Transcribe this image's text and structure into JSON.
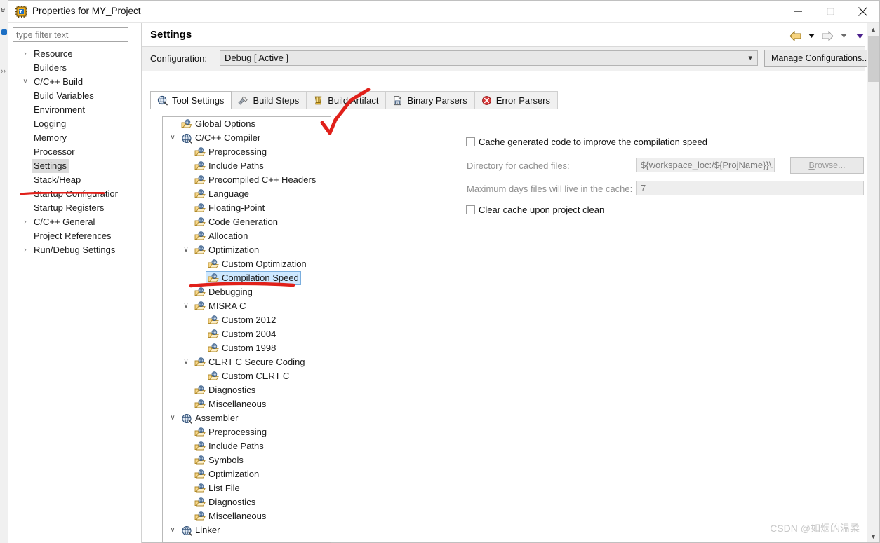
{
  "window": {
    "title": "Properties for MY_Project",
    "icon": "properties-chip-icon",
    "minimize_label": "—",
    "maximize_label": "□",
    "close_label": "✕"
  },
  "sidebar": {
    "filter_placeholder": "type filter text",
    "filter_value": "",
    "items": [
      {
        "label": "Resource",
        "indent": 0,
        "twisty": "collapsed",
        "selected": false
      },
      {
        "label": "Builders",
        "indent": 0,
        "twisty": "none",
        "selected": false
      },
      {
        "label": "C/C++ Build",
        "indent": 0,
        "twisty": "expanded",
        "selected": false
      },
      {
        "label": "Build Variables",
        "indent": 1,
        "twisty": "none",
        "selected": false
      },
      {
        "label": "Environment",
        "indent": 1,
        "twisty": "none",
        "selected": false
      },
      {
        "label": "Logging",
        "indent": 1,
        "twisty": "none",
        "selected": false
      },
      {
        "label": "Memory",
        "indent": 1,
        "twisty": "none",
        "selected": false
      },
      {
        "label": "Processor",
        "indent": 1,
        "twisty": "none",
        "selected": false
      },
      {
        "label": "Settings",
        "indent": 1,
        "twisty": "none",
        "selected": true
      },
      {
        "label": "Stack/Heap",
        "indent": 1,
        "twisty": "none",
        "selected": false
      },
      {
        "label": "Startup Configuratior",
        "indent": 1,
        "twisty": "none",
        "selected": false
      },
      {
        "label": "Startup Registers",
        "indent": 1,
        "twisty": "none",
        "selected": false
      },
      {
        "label": "C/C++ General",
        "indent": 0,
        "twisty": "collapsed",
        "selected": false
      },
      {
        "label": "Project References",
        "indent": 0,
        "twisty": "none",
        "selected": false
      },
      {
        "label": "Run/Debug Settings",
        "indent": 0,
        "twisty": "collapsed",
        "selected": false
      }
    ]
  },
  "page": {
    "title": "Settings",
    "nav": {
      "back_icon": "back-arrow-icon",
      "back_menu_icon": "chevron-down-icon",
      "forward_icon": "forward-arrow-icon",
      "forward_menu_icon": "chevron-down-icon",
      "view_menu_icon": "view-menu-chevron-icon"
    },
    "configuration": {
      "label": "Configuration:",
      "value": "Debug  [ Active ]",
      "dropdown_icon": "chevron-down-icon",
      "manage_button": "Manage Configurations..."
    },
    "tabs": [
      {
        "label": "Tool Settings",
        "icon": "tool-settings-icon",
        "active": true
      },
      {
        "label": "Build Steps",
        "icon": "build-steps-icon",
        "active": false
      },
      {
        "label": "Build Artifact",
        "icon": "build-artifact-icon",
        "active": false
      },
      {
        "label": "Binary Parsers",
        "icon": "binary-parsers-icon",
        "active": false
      },
      {
        "label": "Error Parsers",
        "icon": "error-parsers-icon",
        "active": false
      }
    ]
  },
  "tool_tree": {
    "items": [
      {
        "label": "Global Options",
        "indent": 1,
        "twisty": "none",
        "icon": "option-folder-icon",
        "selected": false
      },
      {
        "label": "C/C++ Compiler",
        "indent": 1,
        "twisty": "expanded",
        "icon": "tool-globe-icon",
        "selected": false
      },
      {
        "label": "Preprocessing",
        "indent": 2,
        "twisty": "none",
        "icon": "option-folder-icon",
        "selected": false
      },
      {
        "label": "Include Paths",
        "indent": 2,
        "twisty": "none",
        "icon": "option-folder-icon",
        "selected": false
      },
      {
        "label": "Precompiled C++ Headers",
        "indent": 2,
        "twisty": "none",
        "icon": "option-folder-icon",
        "selected": false
      },
      {
        "label": "Language",
        "indent": 2,
        "twisty": "none",
        "icon": "option-folder-icon",
        "selected": false
      },
      {
        "label": "Floating-Point",
        "indent": 2,
        "twisty": "none",
        "icon": "option-folder-icon",
        "selected": false
      },
      {
        "label": "Code Generation",
        "indent": 2,
        "twisty": "none",
        "icon": "option-folder-icon",
        "selected": false
      },
      {
        "label": "Allocation",
        "indent": 2,
        "twisty": "none",
        "icon": "option-folder-icon",
        "selected": false
      },
      {
        "label": "Optimization",
        "indent": 2,
        "twisty": "expanded",
        "icon": "option-folder-icon",
        "selected": false
      },
      {
        "label": "Custom Optimization",
        "indent": 3,
        "twisty": "none",
        "icon": "option-folder-icon",
        "selected": false
      },
      {
        "label": "Compilation Speed",
        "indent": 3,
        "twisty": "none",
        "icon": "option-folder-icon",
        "selected": true
      },
      {
        "label": "Debugging",
        "indent": 2,
        "twisty": "none",
        "icon": "option-folder-icon",
        "selected": false
      },
      {
        "label": "MISRA C",
        "indent": 2,
        "twisty": "expanded",
        "icon": "option-folder-icon",
        "selected": false
      },
      {
        "label": "Custom 2012",
        "indent": 3,
        "twisty": "none",
        "icon": "option-folder-icon",
        "selected": false
      },
      {
        "label": "Custom 2004",
        "indent": 3,
        "twisty": "none",
        "icon": "option-folder-icon",
        "selected": false
      },
      {
        "label": "Custom 1998",
        "indent": 3,
        "twisty": "none",
        "icon": "option-folder-icon",
        "selected": false
      },
      {
        "label": "CERT C Secure Coding",
        "indent": 2,
        "twisty": "expanded",
        "icon": "option-folder-icon",
        "selected": false
      },
      {
        "label": "Custom CERT C",
        "indent": 3,
        "twisty": "none",
        "icon": "option-folder-icon",
        "selected": false
      },
      {
        "label": "Diagnostics",
        "indent": 2,
        "twisty": "none",
        "icon": "option-folder-icon",
        "selected": false
      },
      {
        "label": "Miscellaneous",
        "indent": 2,
        "twisty": "none",
        "icon": "option-folder-icon",
        "selected": false
      },
      {
        "label": "Assembler",
        "indent": 1,
        "twisty": "expanded",
        "icon": "tool-globe-icon",
        "selected": false
      },
      {
        "label": "Preprocessing",
        "indent": 2,
        "twisty": "none",
        "icon": "option-folder-icon",
        "selected": false
      },
      {
        "label": "Include Paths",
        "indent": 2,
        "twisty": "none",
        "icon": "option-folder-icon",
        "selected": false
      },
      {
        "label": "Symbols",
        "indent": 2,
        "twisty": "none",
        "icon": "option-folder-icon",
        "selected": false
      },
      {
        "label": "Optimization",
        "indent": 2,
        "twisty": "none",
        "icon": "option-folder-icon",
        "selected": false
      },
      {
        "label": "List File",
        "indent": 2,
        "twisty": "none",
        "icon": "option-folder-icon",
        "selected": false
      },
      {
        "label": "Diagnostics",
        "indent": 2,
        "twisty": "none",
        "icon": "option-folder-icon",
        "selected": false
      },
      {
        "label": "Miscellaneous",
        "indent": 2,
        "twisty": "none",
        "icon": "option-folder-icon",
        "selected": false
      },
      {
        "label": "Linker",
        "indent": 1,
        "twisty": "expanded",
        "icon": "tool-globe-icon",
        "selected": false
      }
    ]
  },
  "form": {
    "cache_checkbox": {
      "label": "Cache generated code to improve the compilation speed",
      "checked": false
    },
    "directory": {
      "label": "Directory for cached files:",
      "value": "${workspace_loc:/${ProjName}}\\.cache",
      "browse_label": "Browse..."
    },
    "max_days": {
      "label": "Maximum days files will live in the cache:",
      "value": "7"
    },
    "clear_cache_checkbox": {
      "label": "Clear cache upon project clean",
      "checked": false
    }
  },
  "scrollbar": {
    "up_arrow": "▲",
    "down_arrow": "▼"
  },
  "background_window": {
    "edge_text": "e"
  },
  "watermark": "CSDN @如烟的温柔",
  "colors": {
    "annotation_red": "#e8241e",
    "selection_blue": "#cde8ff",
    "selection_gray": "#dcdcdc",
    "panel_gray": "#f0f0f0"
  }
}
